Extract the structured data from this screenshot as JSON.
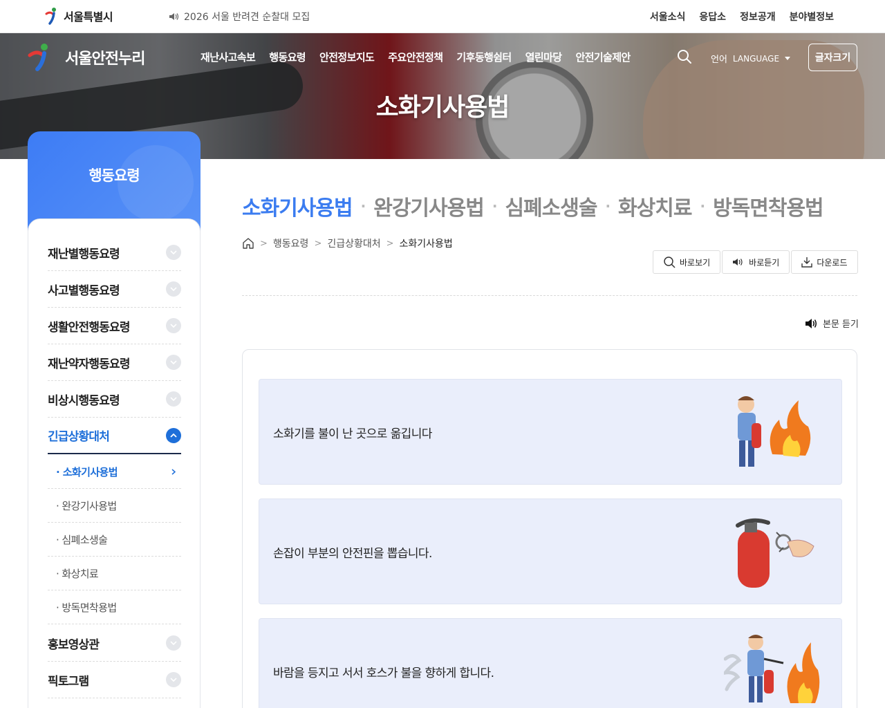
{
  "util": {
    "brand": "서울특별시",
    "notice": "2026 서울 반려견 순찰대 모집",
    "links": [
      "서울소식",
      "응답소",
      "정보공개",
      "분야별정보"
    ]
  },
  "header": {
    "site_name": "서울안전누리",
    "menu": [
      "재난사고속보",
      "행동요령",
      "안전정보지도",
      "주요안전정책",
      "기후동행쉼터",
      "열린마당",
      "안전기술제안"
    ],
    "lang_ko": "언어",
    "lang_en": "LANGUAGE",
    "font_size_btn": "글자크기"
  },
  "hero": {
    "title": "소화기사용법"
  },
  "sidebar": {
    "title": "행동요령",
    "items": [
      {
        "label": "재난별행동요령"
      },
      {
        "label": "사고별행동요령"
      },
      {
        "label": "생활안전행동요령"
      },
      {
        "label": "재난약자행동요령"
      },
      {
        "label": "비상시행동요령"
      },
      {
        "label": "긴급상황대처"
      }
    ],
    "sub_items": [
      {
        "label": "· 소화기사용법"
      },
      {
        "label": "· 완강기사용법"
      },
      {
        "label": "· 심폐소생술"
      },
      {
        "label": "· 화상치료"
      },
      {
        "label": "· 방독면착용법"
      }
    ],
    "items_after": [
      {
        "label": "홍보영상관"
      },
      {
        "label": "픽토그램"
      }
    ]
  },
  "tabs": [
    "소화기사용법",
    "완강기사용법",
    "심폐소생술",
    "화상치료",
    "방독면착용법"
  ],
  "tab_separator": "·",
  "breadcrumb": {
    "items": [
      "행동요령",
      "긴급상황대처",
      "소화기사용법"
    ],
    "sep": ">"
  },
  "tools": {
    "view": "바로보기",
    "listen": "바로듣기",
    "download": "다운로드"
  },
  "listen_body": "본문 듣기",
  "steps": [
    {
      "text": "소화기를 불이 난 곳으로 옮깁니다"
    },
    {
      "text": "손잡이 부분의 안전핀을 뽑습니다."
    },
    {
      "text": "바람을 등지고 서서 호스가 불을 향하게 합니다."
    }
  ],
  "colors": {
    "accent_blue": "#3b7cf0",
    "active_blue": "#1e6fd9",
    "step_bg": "#eaeefb"
  }
}
